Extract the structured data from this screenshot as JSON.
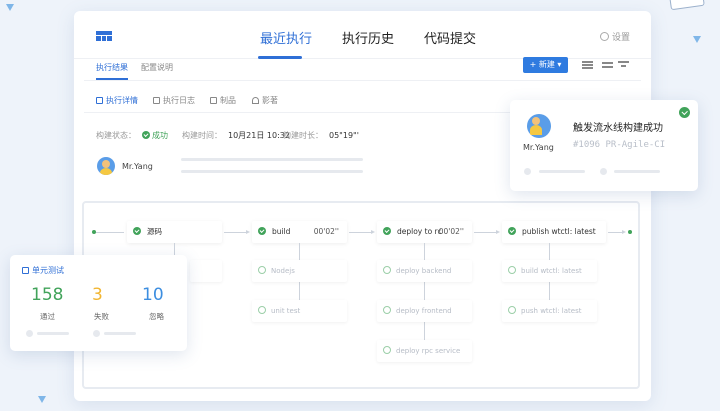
{
  "header": {
    "tabs": [
      {
        "label": "最近执行",
        "active": true
      },
      {
        "label": "执行历史",
        "active": false
      },
      {
        "label": "代码提交",
        "active": false
      }
    ],
    "settings_label": "设置"
  },
  "subtabs": [
    "执行结果",
    "配置说明"
  ],
  "toolbar": {
    "new_label": "+ 新建 ▾"
  },
  "detail_tabs": [
    "执行详情",
    "执行日志",
    "制品",
    "影著"
  ],
  "build_info": {
    "status_label": "构建状态：",
    "status_value": "成功",
    "time_label": "构建时间：",
    "time_value": "10月21日 10:32",
    "duration_label": "构建时长：",
    "duration_value": "05\"19\"'"
  },
  "user": {
    "name": "Mr.Yang"
  },
  "pipeline": {
    "stages": [
      {
        "label": "源码",
        "duration": ""
      },
      {
        "label": "build",
        "duration": "00'02''"
      },
      {
        "label": "deploy to rc",
        "duration": "00'02''"
      },
      {
        "label": "publish wtctl: latest",
        "duration": ""
      }
    ],
    "jobs": [
      {
        "label": "Nodejs"
      },
      {
        "label": "unit test"
      },
      {
        "label": "deploy backend"
      },
      {
        "label": "deploy frontend"
      },
      {
        "label": "deploy rpc service"
      },
      {
        "label": "build wtctl: latest"
      },
      {
        "label": "push wtctl: latest"
      }
    ]
  },
  "unit_test": {
    "title": "单元测试",
    "passed": {
      "value": "158",
      "label": "通过",
      "color": "#41a35a"
    },
    "failed": {
      "value": "3",
      "label": "失败",
      "color": "#f2b632"
    },
    "ignored": {
      "value": "10",
      "label": "忽略",
      "color": "#3d8ee0"
    }
  },
  "trigger": {
    "title": "触发流水线构建成功",
    "subtitle": "#1096 PR-Agile-CI",
    "user": "Mr.Yang"
  },
  "colors": {
    "accent": "#2f6fd6",
    "success": "#41a35a"
  }
}
